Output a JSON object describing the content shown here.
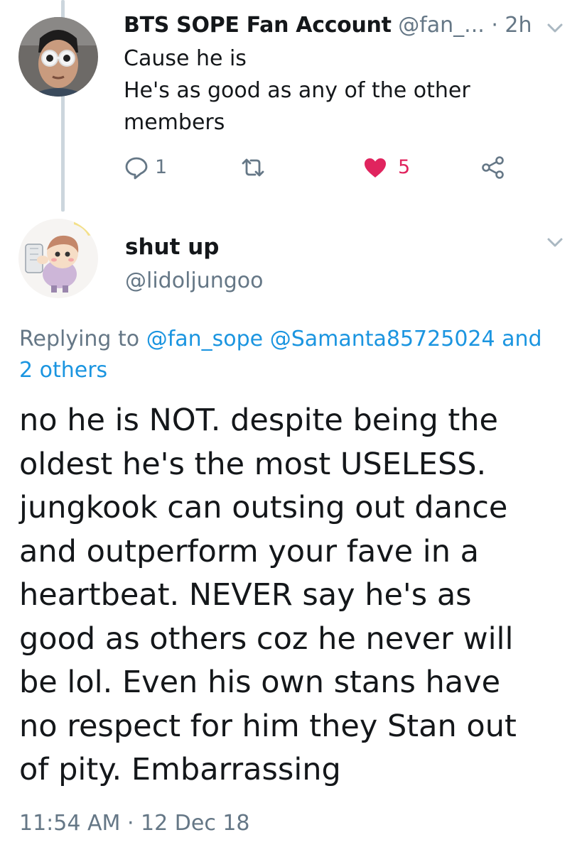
{
  "parent_tweet": {
    "display_name": "BTS SOPE Fan Account",
    "handle": "@fan_...",
    "separator": "·",
    "time_ago": "2h",
    "body_lines": [
      "Cause he is",
      "He's as good as any of the other",
      "members"
    ],
    "reply_count": "1",
    "like_count": "5",
    "liked": true,
    "icons": {
      "reply": "reply-icon",
      "retweet": "retweet-icon",
      "like": "heart-icon",
      "share": "share-icon",
      "menu": "chevron-down-icon"
    }
  },
  "reply_tweet": {
    "display_name": "shut up",
    "handle": "@lidoljungoo",
    "replying_prefix": "Replying to",
    "replying_users": [
      "@fan_sope",
      "@Samanta85725024"
    ],
    "replying_and": "and",
    "replying_others": "2 others",
    "body_lines": [
      "no he is NOT. despite being the",
      "oldest he's the most USELESS.",
      "jungkook can outsing out dance",
      "and outperform your fave in a",
      "heartbeat. NEVER say he's as",
      "good as others coz he never will",
      "be lol. Even his own stans have",
      "no respect for him they Stan out",
      "of pity. Embarrassing"
    ],
    "time": "11:54 AM",
    "separator": "·",
    "date": "12 Dec 18"
  },
  "colors": {
    "link": "#1b95e0",
    "muted": "#657786",
    "like": "#e0245e",
    "text": "#14171a"
  }
}
